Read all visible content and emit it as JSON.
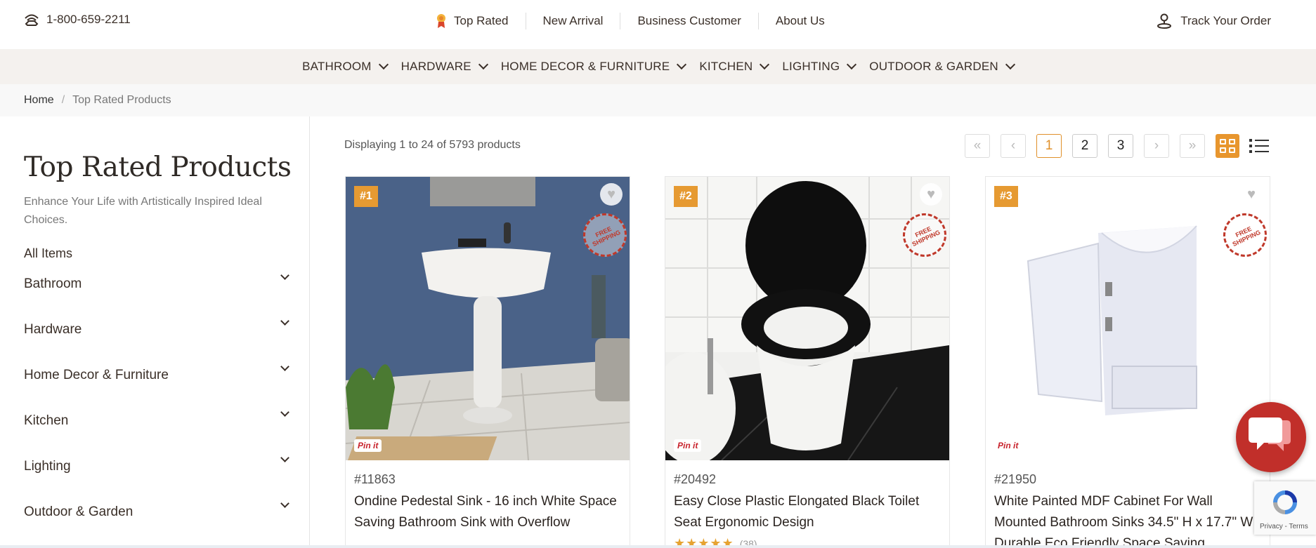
{
  "topbar": {
    "phone": "1-800-659-2211",
    "links": [
      "Top Rated",
      "New Arrival",
      "Business Customer",
      "About Us"
    ],
    "track": "Track Your Order"
  },
  "categories": [
    "BATHROOM",
    "HARDWARE",
    "HOME DECOR & FURNITURE",
    "KITCHEN",
    "LIGHTING",
    "OUTDOOR & GARDEN"
  ],
  "breadcrumb": {
    "home": "Home",
    "separator": "/",
    "current": "Top Rated Products"
  },
  "sidebar": {
    "title": "Top Rated Products",
    "tagline": "Enhance Your Life with Artistically Inspired Ideal Choices.",
    "all": "All Items",
    "items": [
      "Bathroom",
      "Hardware",
      "Home Decor & Furniture",
      "Kitchen",
      "Lighting",
      "Outdoor & Garden"
    ]
  },
  "listing": {
    "count_text": "Displaying 1 to 24 of 5793 products",
    "pages": [
      "1",
      "2",
      "3"
    ],
    "active_page": "1",
    "view_mode": "grid"
  },
  "badge_text": "FREE SHIPPING",
  "pin_label": "Pin it",
  "products": [
    {
      "rank": "#1",
      "sku": "#11863",
      "title": "Ondine Pedestal Sink - 16 inch White Space Saving Bathroom Sink with Overflow",
      "stars": "",
      "reviews": ""
    },
    {
      "rank": "#2",
      "sku": "#20492",
      "title": "Easy Close Plastic Elongated Black Toilet Seat Ergonomic Design",
      "stars": "★★★★★",
      "reviews": "(38)"
    },
    {
      "rank": "#3",
      "sku": "#21950",
      "title": "White Painted MDF Cabinet For Wall Mounted Bathroom Sinks 34.5\" H x 17.7\" W Durable Eco Friendly Space Saving",
      "stars": "",
      "reviews": ""
    }
  ],
  "recaptcha": {
    "label": "Privacy - Terms"
  },
  "colors": {
    "accent": "#e69a32",
    "chat": "#c12f2a",
    "nav_bg": "#f4f1ee"
  }
}
